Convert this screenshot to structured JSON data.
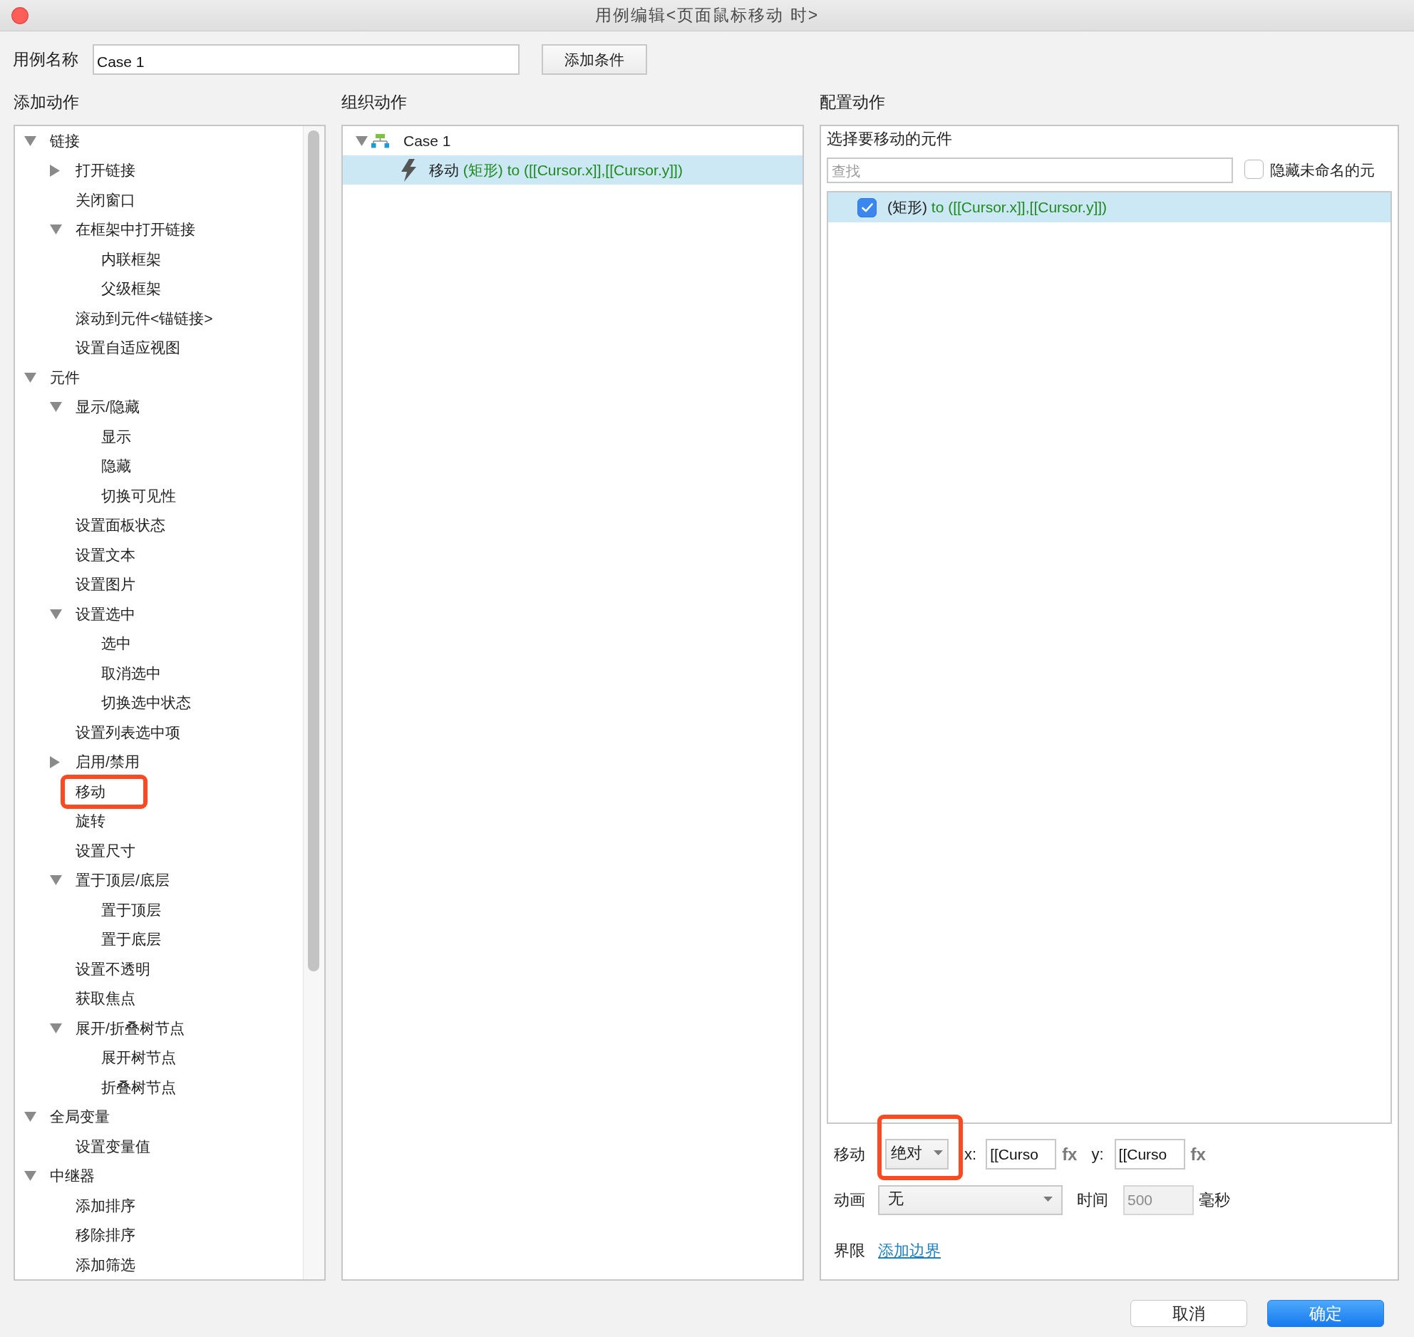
{
  "window": {
    "title": "用例编辑<页面鼠标移动 时>"
  },
  "case_name": {
    "label": "用例名称",
    "value": "Case 1"
  },
  "add_condition_button": "添加条件",
  "add_action": {
    "heading": "添加动作",
    "tree": [
      {
        "label": "链接",
        "expanded": true,
        "selected": false,
        "marked": false,
        "children": [
          {
            "label": "打开链接",
            "expanded": false,
            "selected": false,
            "marked": false
          },
          {
            "label": "关闭窗口",
            "selected": false,
            "marked": false
          },
          {
            "label": "在框架中打开链接",
            "expanded": true,
            "selected": false,
            "marked": false,
            "children": [
              {
                "label": "内联框架",
                "selected": false,
                "marked": false
              },
              {
                "label": "父级框架",
                "selected": false,
                "marked": false
              }
            ]
          },
          {
            "label": "滚动到元件<锚链接>",
            "selected": false,
            "marked": false
          },
          {
            "label": "设置自适应视图",
            "selected": false,
            "marked": false
          }
        ]
      },
      {
        "label": "元件",
        "expanded": true,
        "selected": false,
        "marked": false,
        "children": [
          {
            "label": "显示/隐藏",
            "expanded": true,
            "selected": false,
            "marked": false,
            "children": [
              {
                "label": "显示",
                "selected": false,
                "marked": false
              },
              {
                "label": "隐藏",
                "selected": false,
                "marked": false
              },
              {
                "label": "切换可见性",
                "selected": false,
                "marked": false
              }
            ]
          },
          {
            "label": "设置面板状态",
            "selected": false,
            "marked": false
          },
          {
            "label": "设置文本",
            "selected": false,
            "marked": false
          },
          {
            "label": "设置图片",
            "selected": false,
            "marked": false
          },
          {
            "label": "设置选中",
            "expanded": true,
            "selected": false,
            "marked": false,
            "children": [
              {
                "label": "选中",
                "selected": false,
                "marked": false
              },
              {
                "label": "取消选中",
                "selected": false,
                "marked": false
              },
              {
                "label": "切换选中状态",
                "selected": false,
                "marked": false
              }
            ]
          },
          {
            "label": "设置列表选中项",
            "selected": false,
            "marked": false
          },
          {
            "label": "启用/禁用",
            "expanded": false,
            "selected": false,
            "marked": false
          },
          {
            "label": "移动",
            "selected": false,
            "marked": true
          },
          {
            "label": "旋转",
            "selected": false,
            "marked": false
          },
          {
            "label": "设置尺寸",
            "selected": false,
            "marked": false
          },
          {
            "label": "置于顶层/底层",
            "expanded": true,
            "selected": false,
            "marked": false,
            "children": [
              {
                "label": "置于顶层",
                "selected": false,
                "marked": false
              },
              {
                "label": "置于底层",
                "selected": false,
                "marked": false
              }
            ]
          },
          {
            "label": "设置不透明",
            "selected": false,
            "marked": false
          },
          {
            "label": "获取焦点",
            "selected": false,
            "marked": false
          },
          {
            "label": "展开/折叠树节点",
            "expanded": true,
            "selected": false,
            "marked": false,
            "children": [
              {
                "label": "展开树节点",
                "selected": false,
                "marked": false
              },
              {
                "label": "折叠树节点",
                "selected": false,
                "marked": false
              }
            ]
          }
        ]
      },
      {
        "label": "全局变量",
        "expanded": true,
        "selected": false,
        "marked": false,
        "children": [
          {
            "label": "设置变量值",
            "selected": false,
            "marked": false
          }
        ]
      },
      {
        "label": "中继器",
        "expanded": true,
        "selected": false,
        "marked": false,
        "children": [
          {
            "label": "添加排序",
            "selected": false,
            "marked": false
          },
          {
            "label": "移除排序",
            "selected": false,
            "marked": false
          },
          {
            "label": "添加筛选",
            "selected": false,
            "marked": false
          }
        ]
      }
    ]
  },
  "organize_actions": {
    "heading": "组织动作",
    "tree": [
      {
        "kind": "case",
        "label": "Case 1",
        "expanded": true,
        "selected": false,
        "children": [
          {
            "kind": "action",
            "action": "移动",
            "target": "(矩形) to ([[Cursor.x]],[[Cursor.y]])",
            "selected": true
          }
        ]
      }
    ]
  },
  "configure_action": {
    "heading": "配置动作",
    "subheading": "选择要移动的元件",
    "search": {
      "placeholder": "查找"
    },
    "hide_unnamed": {
      "label": "隐藏未命名的元",
      "checked": false
    },
    "widgets": [
      {
        "name": "(矩形)",
        "target": "to ([[Cursor.x]],[[Cursor.y]])",
        "checked": true,
        "selected": true
      }
    ],
    "move": {
      "label": "移动",
      "mode": {
        "value": "绝对",
        "marked": true
      },
      "x_label": "x:",
      "x_value": "[[Curso",
      "x_fx": "fx",
      "y_label": "y:",
      "y_value": "[[Curso",
      "y_fx": "fx"
    },
    "animation": {
      "label": "动画",
      "value": "无",
      "time_label": "时间",
      "time_value": "500",
      "time_disabled": true,
      "unit": "毫秒"
    },
    "bounds": {
      "label": "界限",
      "link": "添加边界"
    }
  },
  "buttons": [
    {
      "label": "取消",
      "kind": "secondary"
    },
    {
      "label": "确定",
      "kind": "primary"
    }
  ]
}
